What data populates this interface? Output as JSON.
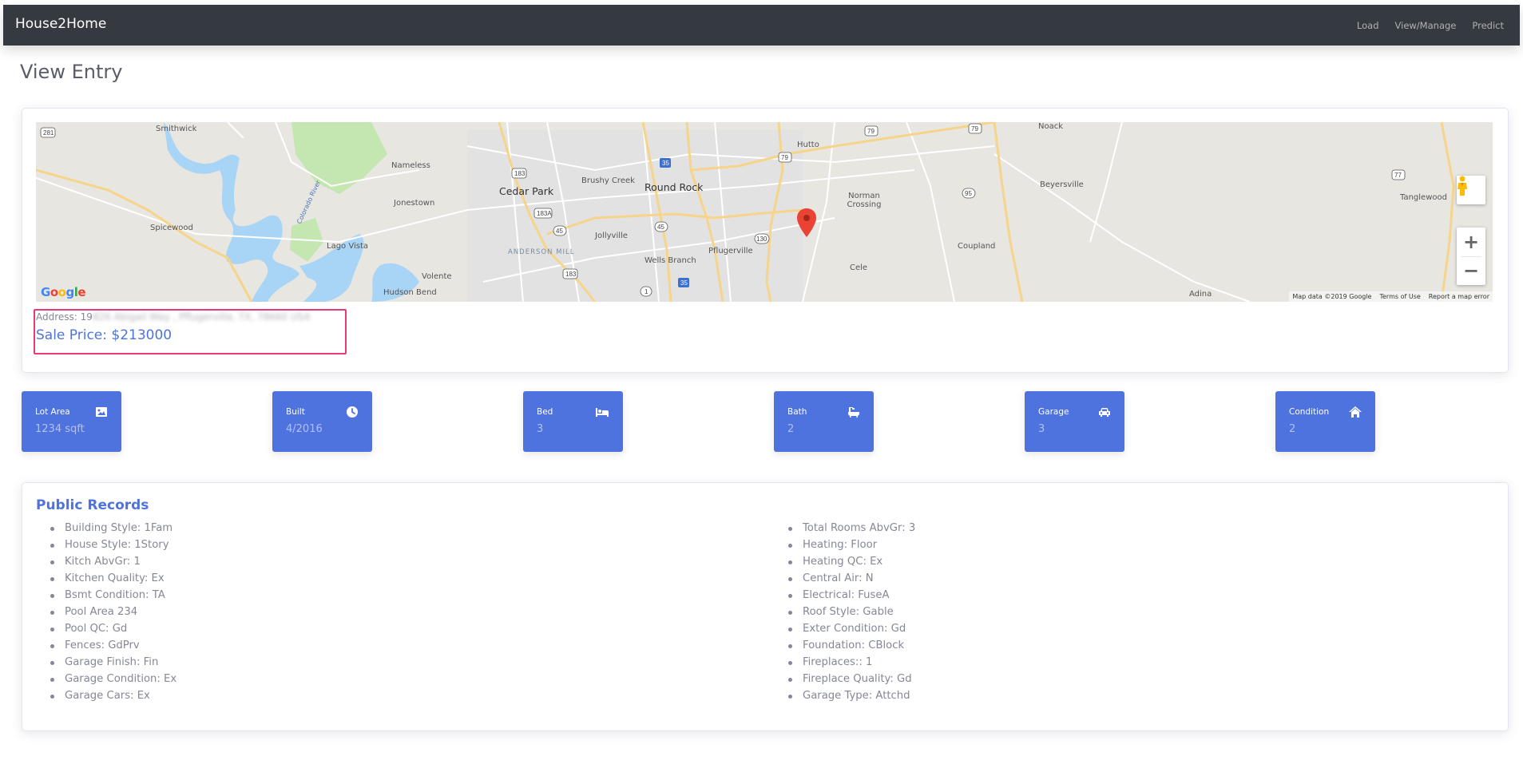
{
  "navbar": {
    "brand": "House2Home",
    "links": [
      "Load",
      "View/Manage",
      "Predict"
    ]
  },
  "page": {
    "title": "View Entry"
  },
  "map": {
    "labels": {
      "smithwick": "Smithwick",
      "spicewood": "Spicewood",
      "lago_vista": "Lago Vista",
      "nameless": "Nameless",
      "jonestown": "Jonestown",
      "volente": "Volente",
      "hudson_bend": "Hudson Bend",
      "cedar_park": "Cedar Park",
      "brushy_creek": "Brushy Creek",
      "round_rock": "Round Rock",
      "jollyville": "Jollyville",
      "anderson_mill": "ANDERSON MILL",
      "wells_branch": "Wells Branch",
      "pflugerville": "Pflugerville",
      "hutto": "Hutto",
      "norman_crossing": "Norman Crossing",
      "cele": "Cele",
      "noack": "Noack",
      "beyersville": "Beyersville",
      "coupland": "Coupland",
      "adina": "Adina",
      "tanglewood": "Tanglewood",
      "colorado_river": "Colorado River"
    },
    "google_logo": "Google",
    "attribution": {
      "map_data": "Map data ©2019 Google",
      "terms": "Terms of Use",
      "report": "Report a map error"
    },
    "controls": {
      "zoom_in": "+",
      "zoom_out": "−"
    },
    "marker_color": "#ea4335"
  },
  "entry": {
    "address_label": "Address: 19",
    "address_redacted": "826 Abigail Way , Pflugerville, TX, 78660 USA",
    "sale_price": "Sale Price: $213000"
  },
  "stats": [
    {
      "label": "Lot Area",
      "value": "1234 sqft",
      "icon": "image-icon"
    },
    {
      "label": "Built",
      "value": "4/2016",
      "icon": "clock-icon"
    },
    {
      "label": "Bed",
      "value": "3",
      "icon": "bed-icon"
    },
    {
      "label": "Bath",
      "value": "2",
      "icon": "bath-icon"
    },
    {
      "label": "Garage",
      "value": "3",
      "icon": "car-icon"
    },
    {
      "label": "Condition",
      "value": "2",
      "icon": "home-icon"
    }
  ],
  "public_records": {
    "title": "Public Records",
    "left": [
      "Building Style: 1Fam",
      "House Style: 1Story",
      "Kitch AbvGr: 1",
      "Kitchen Quality: Ex",
      "Bsmt Condition: TA",
      "Pool Area 234",
      "Pool QC: Gd",
      "Fences: GdPrv",
      "Garage Finish: Fin",
      "Garage Condition: Ex",
      "Garage Cars: Ex"
    ],
    "right": [
      "Total Rooms AbvGr: 3",
      "Heating: Floor",
      "Heating QC: Ex",
      "Central Air: N",
      "Electrical: FuseA",
      "Roof Style: Gable",
      "Exter Condition: Gd",
      "Foundation: CBlock",
      "Fireplaces:: 1",
      "Fireplace Quality: Gd",
      "Garage Type: Attchd"
    ]
  },
  "colors": {
    "primary": "#4e73df",
    "navbar": "#343a40",
    "highlight": "#ec3873",
    "text_muted": "#858796"
  }
}
